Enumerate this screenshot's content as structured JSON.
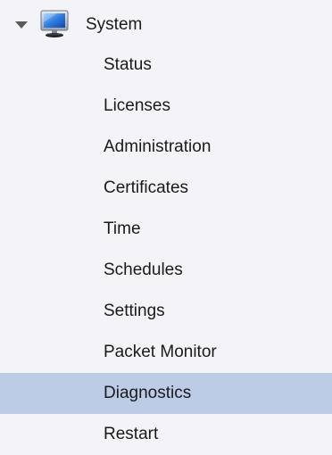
{
  "tree": {
    "root": {
      "label": "System",
      "icon": "monitor-icon",
      "expanded": true
    },
    "items": [
      {
        "label": "Status",
        "selected": false
      },
      {
        "label": "Licenses",
        "selected": false
      },
      {
        "label": "Administration",
        "selected": false
      },
      {
        "label": "Certificates",
        "selected": false
      },
      {
        "label": "Time",
        "selected": false
      },
      {
        "label": "Schedules",
        "selected": false
      },
      {
        "label": "Settings",
        "selected": false
      },
      {
        "label": "Packet Monitor",
        "selected": false
      },
      {
        "label": "Diagnostics",
        "selected": true
      },
      {
        "label": "Restart",
        "selected": false
      }
    ]
  },
  "colors": {
    "background": "#f4f4f8",
    "selected_row": "#bccbe6",
    "text": "#1a1a1a"
  }
}
